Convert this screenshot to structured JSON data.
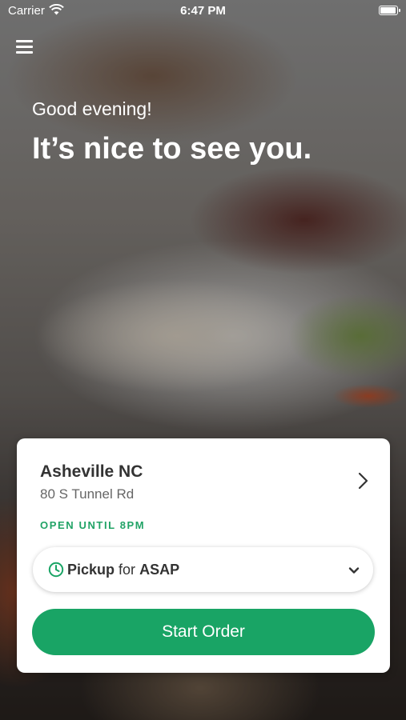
{
  "status_bar": {
    "carrier": "Carrier",
    "time": "6:47 PM",
    "battery_level": 1.0
  },
  "header": {
    "menu_icon": "hamburger-menu-icon",
    "greeting_small": "Good evening!",
    "greeting_large": "It’s nice to see you."
  },
  "location_card": {
    "name": "Asheville NC",
    "address": "80 S Tunnel Rd",
    "open_status": "OPEN UNTIL 8PM",
    "order_mode": {
      "icon": "clock-icon",
      "mode": "Pickup",
      "connector": "for",
      "time": "ASAP"
    },
    "start_button_label": "Start Order"
  },
  "colors": {
    "accent_green": "#19a465",
    "open_status_green": "#21a366"
  }
}
